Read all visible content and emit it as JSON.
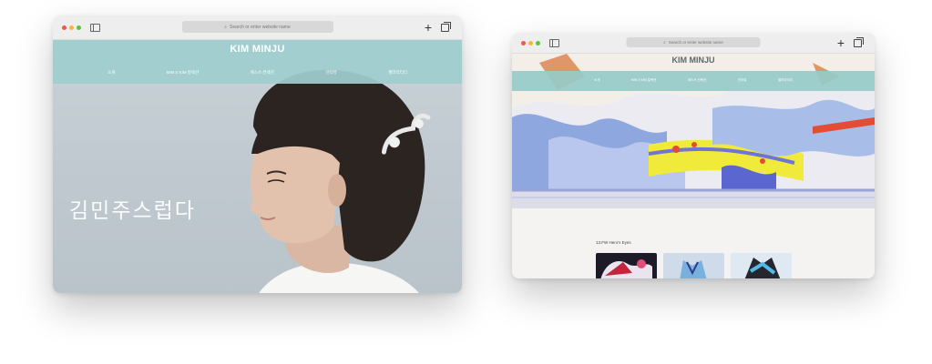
{
  "browser": {
    "address_placeholder": "Search or enter website name"
  },
  "site1": {
    "brand": "KIM MINJU",
    "nav": [
      "소개",
      "MIN X KIM 컬렉션",
      "에스쓰 컨렉션",
      "인터뷰",
      "젤러리티티"
    ],
    "hero_title": "김민주스럽다"
  },
  "site2": {
    "brand": "KIM MINJU",
    "nav": [
      "소개",
      "MIN X KIM 컬렉션",
      "에스쓰 컨렉션",
      "인터뷰",
      "젤러리티티"
    ],
    "section_title": "13.FW Hero's Eyes"
  },
  "colors": {
    "header_teal": "#9fcecf",
    "window_chrome": "#eeeeee"
  }
}
